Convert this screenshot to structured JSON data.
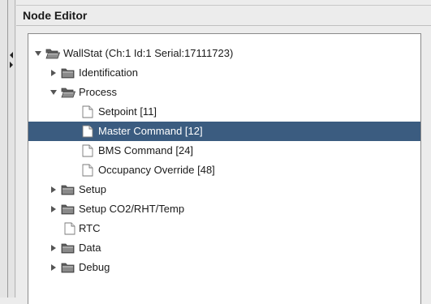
{
  "panel": {
    "title": "Node Editor"
  },
  "tree": {
    "root": {
      "label": "WallStat (Ch:1 Id:1 Serial:17111723)",
      "icon": "folder-open-icon",
      "expanded": true
    },
    "identification": {
      "label": "Identification",
      "icon": "folder-icon",
      "expanded": false
    },
    "process": {
      "label": "Process",
      "icon": "folder-open-icon",
      "expanded": true
    },
    "setpoint": {
      "label": "Setpoint [11]",
      "icon": "file-icon"
    },
    "master_command": {
      "label": "Master Command [12]",
      "icon": "file-icon",
      "selected": true
    },
    "bms_command": {
      "label": "BMS Command [24]",
      "icon": "file-icon"
    },
    "occupancy_override": {
      "label": "Occupancy Override [48]",
      "icon": "file-icon"
    },
    "setup": {
      "label": "Setup",
      "icon": "folder-icon",
      "expanded": false
    },
    "setup_co2": {
      "label": "Setup CO2/RHT/Temp",
      "icon": "folder-icon",
      "expanded": false
    },
    "rtc": {
      "label": "RTC",
      "icon": "file-icon"
    },
    "data": {
      "label": "Data",
      "icon": "folder-icon",
      "expanded": false
    },
    "debug": {
      "label": "Debug",
      "icon": "folder-icon",
      "expanded": false
    }
  },
  "colors": {
    "selection": "#3b5c80",
    "folder": "#5a5a5a"
  }
}
